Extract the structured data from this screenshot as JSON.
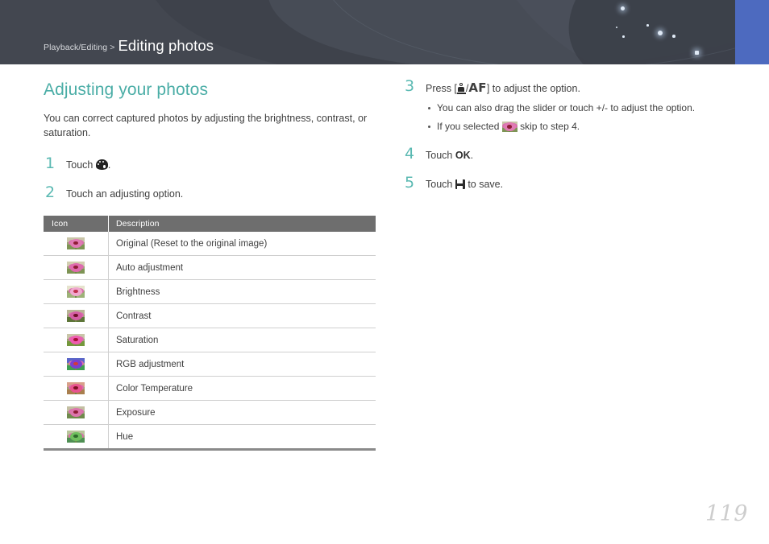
{
  "header": {
    "breadcrumb_parent": "Playback/Editing",
    "breadcrumb_separator": ">",
    "breadcrumb_current": "Editing photos",
    "background_color": "#434750",
    "accent_block_color": "#4d6abf"
  },
  "content": {
    "section_title": "Adjusting your photos",
    "title_color": "#4aada6",
    "intro": "You can correct captured photos by adjusting the brightness, contrast, or saturation."
  },
  "steps": {
    "step1": {
      "number": "1",
      "text_before": "Touch",
      "text_after": "."
    },
    "step2": {
      "number": "2",
      "text": "Touch an adjusting option."
    },
    "step3": {
      "number": "3",
      "text_before": "Press [",
      "af_label": "AF",
      "separator": "/",
      "text_after": "] to adjust the option.",
      "bullets": [
        {
          "text": "You can also drag the slider or touch +/- to adjust the option."
        },
        {
          "text_before": "If you selected",
          "text_after": "skip to step 4."
        }
      ]
    },
    "step4": {
      "number": "4",
      "text_before": "Touch",
      "bold": "OK",
      "text_after": "."
    },
    "step5": {
      "number": "5",
      "text_before": "Touch",
      "text_after": "to save."
    }
  },
  "table": {
    "headers": {
      "icon": "Icon",
      "description": "Description"
    },
    "header_bg": "#6e6e6e",
    "rows": [
      {
        "icon_variant": "v-orig",
        "description": "Original (Reset to the original image)"
      },
      {
        "icon_variant": "v-auto",
        "description": "Auto adjustment"
      },
      {
        "icon_variant": "v-bright",
        "description": "Brightness"
      },
      {
        "icon_variant": "v-contrast",
        "description": "Contrast"
      },
      {
        "icon_variant": "v-sat",
        "description": "Saturation"
      },
      {
        "icon_variant": "v-rgb",
        "description": "RGB adjustment"
      },
      {
        "icon_variant": "v-temp",
        "description": "Color Temperature"
      },
      {
        "icon_variant": "v-exp",
        "description": "Exposure"
      },
      {
        "icon_variant": "v-hue",
        "description": "Hue"
      }
    ]
  },
  "footer": {
    "page_number": "119"
  }
}
